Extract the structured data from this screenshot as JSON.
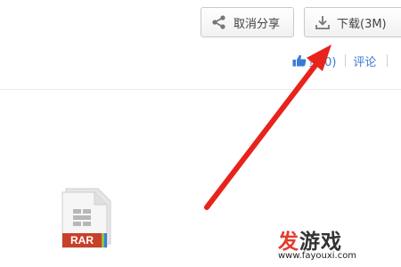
{
  "toolbar": {
    "cancel_share_label": "取消分享",
    "download_label": "下载(3M)"
  },
  "actions": {
    "like_text": "赞(0)",
    "comment_label": "评论"
  },
  "file": {
    "type_label": "RAR"
  },
  "watermark": {
    "brand_part1": "发",
    "brand_part2": "游戏",
    "url": "www.fayouxi.com"
  },
  "colors": {
    "accent_blue": "#3b7bd6",
    "arrow_red": "#e8231c",
    "rar_badge": "#c8402a",
    "brand_red": "#e53b2e"
  },
  "icons": {
    "cancel_share": "share-icon",
    "download": "download-icon",
    "like": "thumbs-up-icon"
  }
}
